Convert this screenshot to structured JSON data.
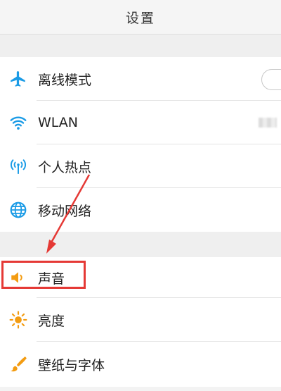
{
  "header": {
    "title": "设置"
  },
  "group1": [
    {
      "label": "离线模式",
      "icon": "airplane-icon"
    },
    {
      "label": "WLAN",
      "icon": "wifi-icon"
    },
    {
      "label": "个人热点",
      "icon": "hotspot-icon"
    },
    {
      "label": "移动网络",
      "icon": "globe-icon"
    }
  ],
  "group2": [
    {
      "label": "声音",
      "icon": "speaker-icon"
    },
    {
      "label": "亮度",
      "icon": "sun-icon"
    },
    {
      "label": "壁纸与字体",
      "icon": "brush-icon"
    }
  ],
  "colors": {
    "network_icon": "#1a9be6",
    "display_icon": "#f39c12",
    "annotation": "#e53935"
  }
}
